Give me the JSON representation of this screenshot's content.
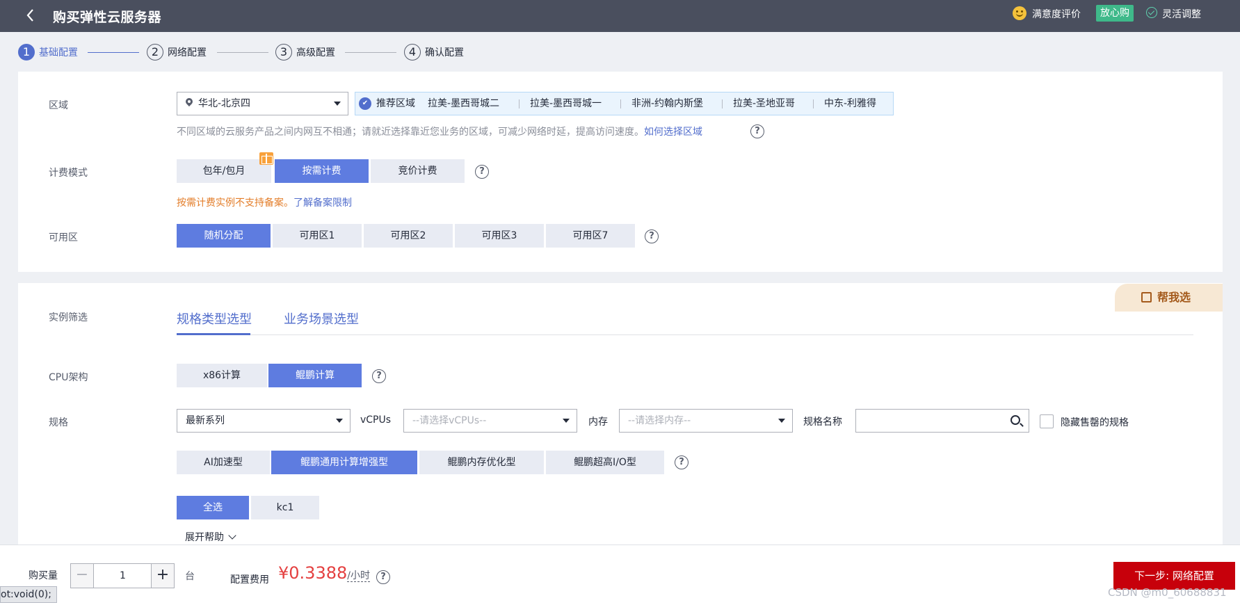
{
  "header": {
    "title": "购买弹性云服务器",
    "satisfaction": "满意度评价",
    "badge": "放心购",
    "flexible": "灵活调整"
  },
  "steps": [
    {
      "num": "1",
      "label": "基础配置"
    },
    {
      "num": "2",
      "label": "网络配置"
    },
    {
      "num": "3",
      "label": "高级配置"
    },
    {
      "num": "4",
      "label": "确认配置"
    }
  ],
  "region": {
    "label": "区域",
    "value": "华北-北京四",
    "recommend_label": "推荐区域",
    "recommended": [
      "拉美-墨西哥城二",
      "拉美-墨西哥城一",
      "非洲-约翰内斯堡",
      "拉美-圣地亚哥",
      "中东-利雅得"
    ],
    "hint": "不同区域的云服务产品之间内网互不相通；请就近选择靠近您业务的区域，可减少网络时延，提高访问速度。",
    "hint_link": "如何选择区域"
  },
  "billing": {
    "label": "计费模式",
    "options": [
      "包年/包月",
      "按需计费",
      "竞价计费"
    ],
    "selected": "按需计费",
    "warning": "按需计费实例不支持备案。",
    "warning_link": "了解备案限制"
  },
  "zone": {
    "label": "可用区",
    "options": [
      "随机分配",
      "可用区1",
      "可用区2",
      "可用区3",
      "可用区7"
    ],
    "selected": "随机分配"
  },
  "filter": {
    "label": "实例筛选",
    "tabs": [
      "规格类型选型",
      "业务场景选型"
    ],
    "help_me": "帮我选"
  },
  "cpu": {
    "label": "CPU架构",
    "options": [
      "x86计算",
      "鲲鹏计算"
    ],
    "selected": "鲲鹏计算"
  },
  "spec": {
    "label": "规格",
    "series": "最新系列",
    "vcpus_label": "vCPUs",
    "vcpus_placeholder": "--请选择vCPUs--",
    "memory_label": "内存",
    "memory_placeholder": "--请选择内存--",
    "name_label": "规格名称",
    "name_value": "",
    "hide_soldout": "隐藏售罄的规格",
    "types": [
      "AI加速型",
      "鲲鹏通用计算增强型",
      "鲲鹏内存优化型",
      "鲲鹏超高I/O型"
    ],
    "selected_type": "鲲鹏通用计算增强型",
    "families": [
      "全选",
      "kc1"
    ],
    "selected_family": "全选",
    "expand": "展开帮助"
  },
  "footer": {
    "qty_label": "购买量",
    "qty_value": "1",
    "qty_unit": "台",
    "fee_label": "配置费用",
    "price": "¥0.3388",
    "price_unit": "/小时",
    "next": "下一步: 网络配置",
    "status_text": "ot:void(0);",
    "watermark": "CSDN @m0_60688831"
  },
  "colors": {
    "header_bg": "#4a4f5e",
    "primary": "#5e7ce0",
    "next_button": "#c7000b",
    "price": "#e44040",
    "warning": "#e37d29"
  }
}
